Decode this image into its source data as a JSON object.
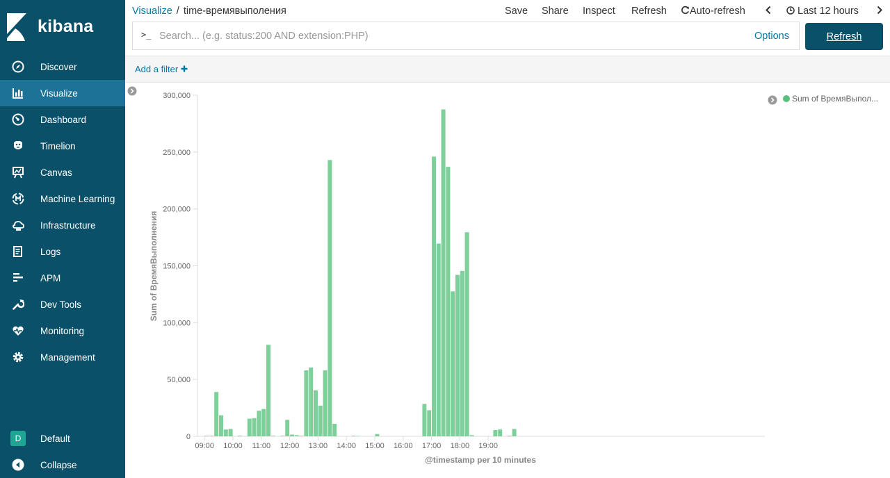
{
  "app": {
    "brand": "kibana"
  },
  "colors": {
    "sidebar": "#0b5069",
    "sidebar_active": "#1c7397",
    "link": "#0079a5",
    "bar": "#7ed09a",
    "legend_dot": "#57c17b"
  },
  "sidebar": {
    "items": [
      {
        "label": "Discover",
        "icon": "compass-icon"
      },
      {
        "label": "Visualize",
        "icon": "visualize-icon",
        "active": true
      },
      {
        "label": "Dashboard",
        "icon": "dashboard-icon"
      },
      {
        "label": "Timelion",
        "icon": "timelion-icon"
      },
      {
        "label": "Canvas",
        "icon": "canvas-icon"
      },
      {
        "label": "Machine Learning",
        "icon": "machine-learning-icon"
      },
      {
        "label": "Infrastructure",
        "icon": "infrastructure-icon"
      },
      {
        "label": "Logs",
        "icon": "logs-icon"
      },
      {
        "label": "APM",
        "icon": "apm-icon"
      },
      {
        "label": "Dev Tools",
        "icon": "wrench-icon"
      },
      {
        "label": "Monitoring",
        "icon": "heartbeat-icon"
      },
      {
        "label": "Management",
        "icon": "gear-icon"
      }
    ],
    "space": {
      "badge": "D",
      "label": "Default"
    },
    "collapse": {
      "label": "Collapse"
    }
  },
  "breadcrumb": {
    "parent": "Visualize",
    "separator": "/",
    "current": "time-времявыполения"
  },
  "toolbar": {
    "save": "Save",
    "share": "Share",
    "inspect": "Inspect",
    "refresh": "Refresh",
    "auto_refresh": "Auto-refresh",
    "time_range": "Last 12 hours"
  },
  "query": {
    "placeholder": "Search... (e.g. status:200 AND extension:PHP)",
    "value": "",
    "prompt": ">_",
    "options": "Options"
  },
  "refresh_button": "Refresh",
  "filter": {
    "add_label": "Add a filter"
  },
  "chart_data": {
    "type": "bar",
    "x_interval": "10 minutes",
    "xlabel": "@timestamp per 10 minutes",
    "ylabel": "Sum of ВремяВыполнения",
    "ylim": [
      0,
      300000
    ],
    "y_ticks": [
      "0",
      "50,000",
      "100,000",
      "150,000",
      "200,000",
      "250,000",
      "300,000"
    ],
    "x_ticks": [
      "09:00",
      "10:00",
      "11:00",
      "12:00",
      "13:00",
      "14:00",
      "15:00",
      "16:00",
      "17:00",
      "18:00",
      "19:00"
    ],
    "legend": {
      "label": "Sum of ВремяВыпол...",
      "placement": "top-right"
    },
    "grid": false,
    "series": [
      {
        "name": "Sum of ВремяВыполнения",
        "points": [
          {
            "x": "09:00",
            "y": 500
          },
          {
            "x": "09:10",
            "y": 500
          },
          {
            "x": "09:20",
            "y": 39000
          },
          {
            "x": "09:30",
            "y": 18500
          },
          {
            "x": "09:40",
            "y": 6000
          },
          {
            "x": "09:50",
            "y": 6500
          },
          {
            "x": "10:10",
            "y": 500
          },
          {
            "x": "10:30",
            "y": 15500
          },
          {
            "x": "10:40",
            "y": 16000
          },
          {
            "x": "10:50",
            "y": 22500
          },
          {
            "x": "11:00",
            "y": 24000
          },
          {
            "x": "11:10",
            "y": 80500
          },
          {
            "x": "11:20",
            "y": 500
          },
          {
            "x": "11:40",
            "y": 500
          },
          {
            "x": "11:50",
            "y": 14500
          },
          {
            "x": "12:00",
            "y": 1500
          },
          {
            "x": "12:10",
            "y": 1000
          },
          {
            "x": "12:20",
            "y": 500
          },
          {
            "x": "12:30",
            "y": 58000
          },
          {
            "x": "12:40",
            "y": 60500
          },
          {
            "x": "12:50",
            "y": 40500
          },
          {
            "x": "13:00",
            "y": 27000
          },
          {
            "x": "13:10",
            "y": 58000
          },
          {
            "x": "13:20",
            "y": 243000
          },
          {
            "x": "13:30",
            "y": 11000
          },
          {
            "x": "14:10",
            "y": 500
          },
          {
            "x": "14:20",
            "y": 300
          },
          {
            "x": "15:00",
            "y": 2000
          },
          {
            "x": "16:40",
            "y": 28500
          },
          {
            "x": "16:50",
            "y": 23000
          },
          {
            "x": "17:00",
            "y": 246000
          },
          {
            "x": "17:10",
            "y": 169500
          },
          {
            "x": "17:20",
            "y": 287500
          },
          {
            "x": "17:30",
            "y": 237000
          },
          {
            "x": "17:40",
            "y": 127500
          },
          {
            "x": "17:50",
            "y": 142000
          },
          {
            "x": "18:00",
            "y": 145500
          },
          {
            "x": "18:10",
            "y": 179500
          },
          {
            "x": "18:20",
            "y": 1000
          },
          {
            "x": "19:10",
            "y": 5500
          },
          {
            "x": "19:20",
            "y": 6000
          },
          {
            "x": "19:40",
            "y": 500
          },
          {
            "x": "19:50",
            "y": 6500
          }
        ]
      }
    ]
  }
}
